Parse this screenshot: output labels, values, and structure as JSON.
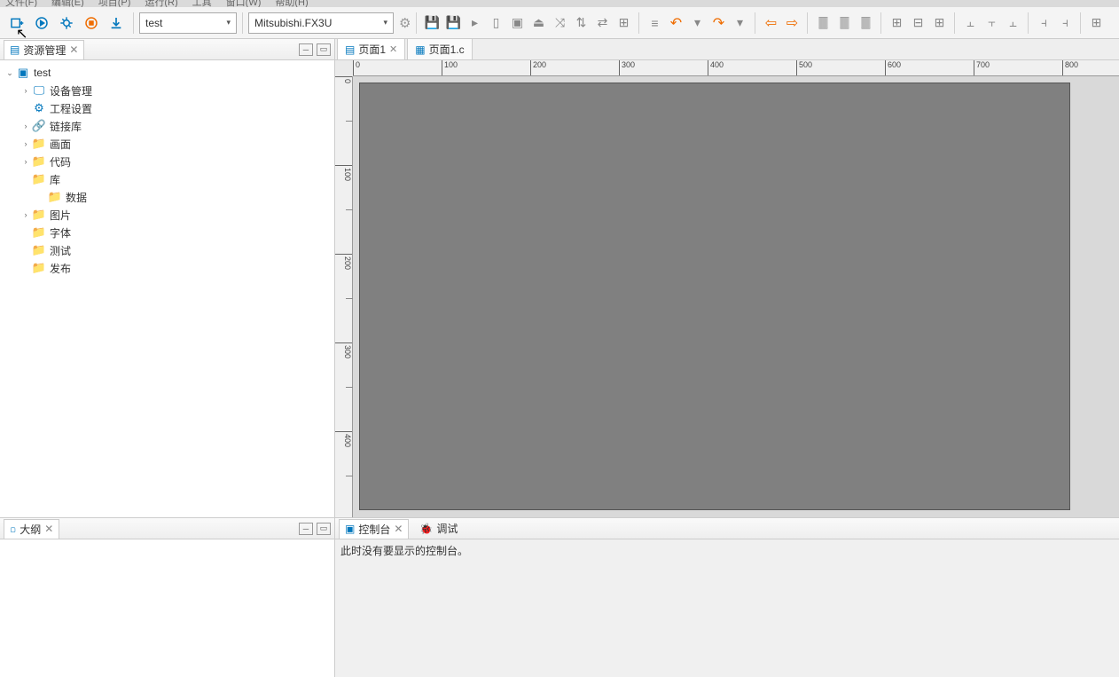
{
  "menu": [
    "文件(F)",
    "编辑(E)",
    "项目(P)",
    "运行(R)",
    "工具",
    "窗口(W)",
    "帮助(H)"
  ],
  "toolbar": {
    "project_combo": "test",
    "device_combo": "Mitsubishi.FX3U"
  },
  "panes": {
    "resource_title": "资源管理",
    "outline_title": "大纲",
    "console_title": "控制台",
    "debug_title": "调试"
  },
  "tree": {
    "root": "test",
    "items": [
      {
        "label": "设备管理",
        "icon": "monitor",
        "indent": 1,
        "twisty": ">"
      },
      {
        "label": "工程设置",
        "icon": "gear-b",
        "indent": 1,
        "twisty": ""
      },
      {
        "label": "链接库",
        "icon": "link",
        "indent": 1,
        "twisty": ">"
      },
      {
        "label": "画面",
        "icon": "folder-o",
        "indent": 1,
        "twisty": ">"
      },
      {
        "label": "代码",
        "icon": "folder-o",
        "indent": 1,
        "twisty": ">"
      },
      {
        "label": "库",
        "icon": "folder-o",
        "indent": 1,
        "twisty": ""
      },
      {
        "label": "数据",
        "icon": "folder-o",
        "indent": 2,
        "twisty": ""
      },
      {
        "label": "图片",
        "icon": "folder-o",
        "indent": 1,
        "twisty": ">"
      },
      {
        "label": "字体",
        "icon": "folder-o",
        "indent": 1,
        "twisty": ""
      },
      {
        "label": "测试",
        "icon": "folder-o",
        "indent": 1,
        "twisty": ""
      },
      {
        "label": "发布",
        "icon": "folder-o",
        "indent": 1,
        "twisty": ""
      }
    ]
  },
  "editor": {
    "tabs": [
      {
        "label": "页面1",
        "active": true,
        "icon": "page"
      },
      {
        "label": "页面1.c",
        "active": false,
        "icon": "cfile"
      }
    ],
    "ruler_h": [
      "0",
      "100",
      "200",
      "300",
      "400",
      "500",
      "600",
      "700",
      "800"
    ],
    "ruler_v": [
      "0",
      "100",
      "200",
      "300",
      "400"
    ]
  },
  "console": {
    "empty_text": "此时没有要显示的控制台。"
  }
}
